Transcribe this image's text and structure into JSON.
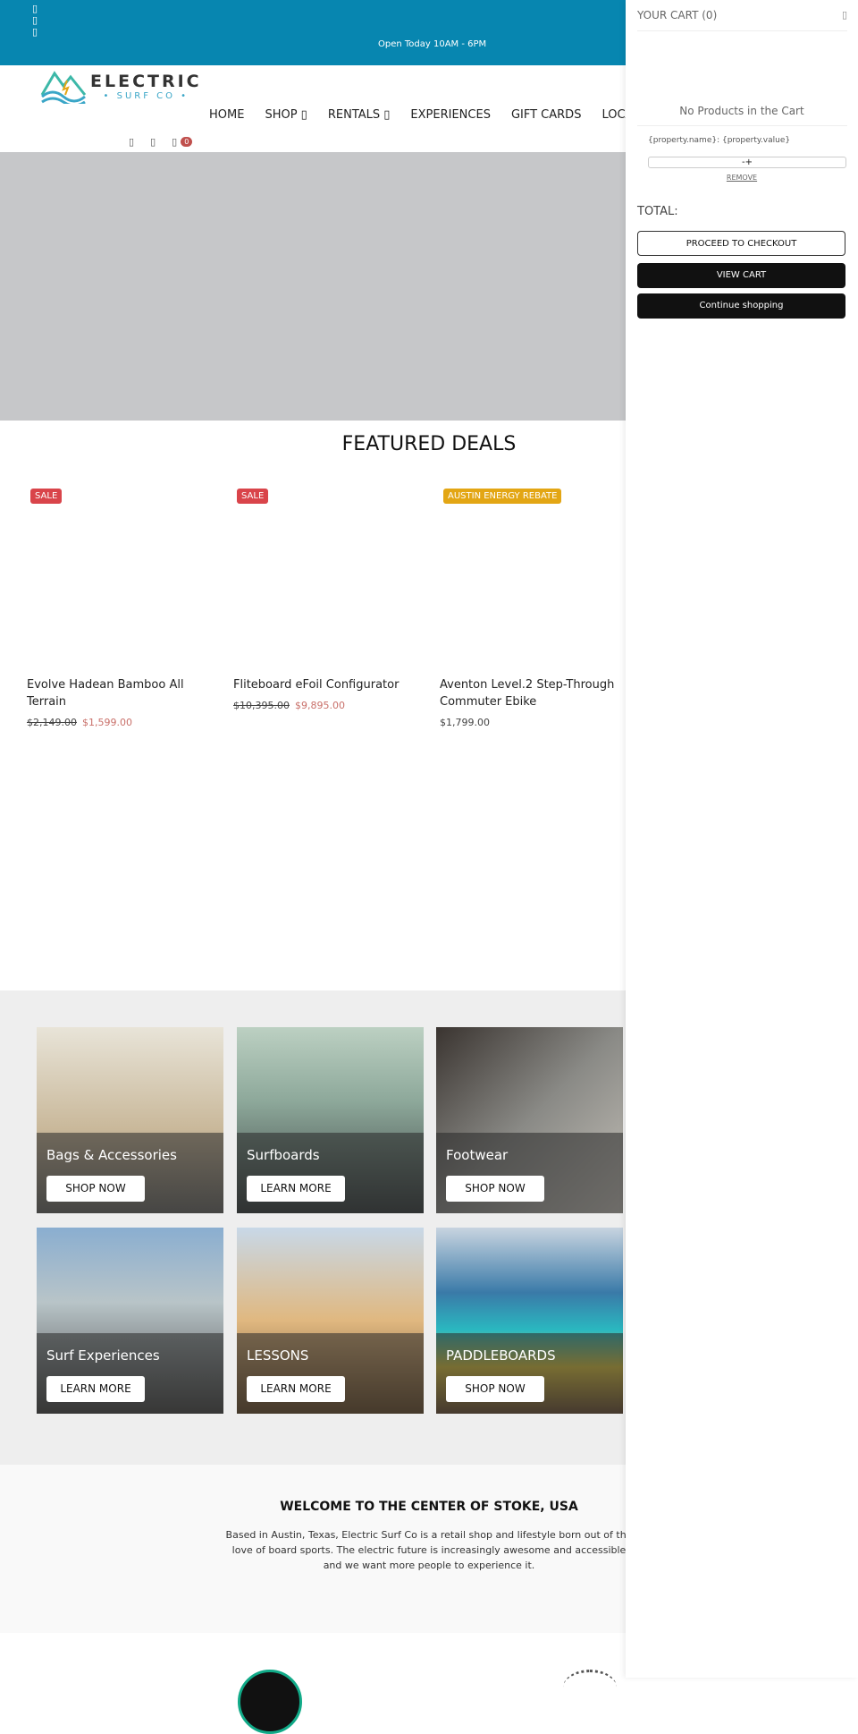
{
  "topbar": {
    "social_icons": [
      "facebook-icon",
      "instagram-icon",
      "youtube-icon"
    ],
    "hours": "Open Today 10AM - 6PM"
  },
  "logo": {
    "line1": "ELECTRIC",
    "line2": "• SURF CO •"
  },
  "nav": [
    "HOME",
    "SHOP ▯",
    "RENTALS ▯",
    "EXPERIENCES",
    "GIFT CARDS",
    "LOCATIONS"
  ],
  "header_icons": {
    "cart_count": "0"
  },
  "featured": {
    "title": "FEATURED DEALS",
    "products": [
      {
        "badge": "SALE",
        "badge_color": "#d9444a",
        "name": "Evolve Hadean Bamboo All Terrain",
        "old_price": "$2,149.00",
        "price": "$1,599.00"
      },
      {
        "badge": "SALE",
        "badge_color": "#d9444a",
        "name": "Fliteboard eFoil Configurator",
        "old_price": "$10,395.00",
        "price": "$9,895.00"
      },
      {
        "badge": "AUSTIN ENERGY REBATE",
        "badge_color": "#e3a614",
        "name": "Aventon Level.2 Step-Through Commuter Ebike",
        "old_price": "",
        "price": "$1,799.00"
      }
    ]
  },
  "categories": [
    {
      "label": "Bags & Accessories",
      "button": "SHOP NOW"
    },
    {
      "label": "Surfboards",
      "button": "LEARN MORE"
    },
    {
      "label": "Footwear",
      "button": "SHOP NOW"
    },
    {
      "label": "Surf Experiences",
      "button": "LEARN MORE"
    },
    {
      "label": "LESSONS",
      "button": "LEARN MORE"
    },
    {
      "label": "PADDLEBOARDS",
      "button": "SHOP NOW"
    }
  ],
  "welcome": {
    "title": "WELCOME TO THE CENTER OF STOKE, USA",
    "text": "Based in Austin, Texas, Electric Surf Co is a retail shop and lifestyle born out of the love of board sports. The electric future is increasingly awesome and accessible and we want more people to experience it."
  },
  "cart": {
    "title": "YOUR CART (0)",
    "empty": "No Products in the Cart",
    "property": "{property.name}: {property.value}",
    "qty": "-+",
    "remove": "REMOVE",
    "total": "TOTAL:",
    "checkout": "PROCEED TO CHECKOUT",
    "view_cart": "VIEW CART",
    "continue": "Continue shopping"
  }
}
